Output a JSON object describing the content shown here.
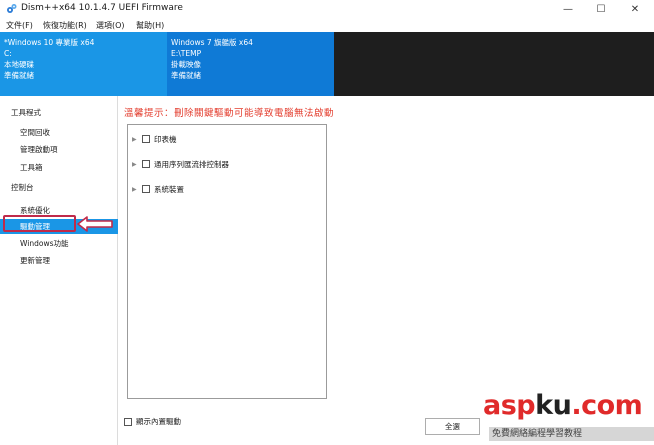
{
  "window": {
    "title": "Dism++x64 10.1.4.7 UEFI Firmware",
    "icon": "dism-gear-icon",
    "controls": {
      "minimize": "—",
      "maximize": "☐",
      "close": "✕"
    }
  },
  "menubar": {
    "items": [
      "文件(F)",
      "恢復功能(R)",
      "選項(O)",
      "幫助(H)"
    ]
  },
  "sessions": [
    {
      "name": "*Windows 10 專業版 x64",
      "path": "C:",
      "type": "本地硬碟",
      "status": "準備就緒",
      "color": "#1a96e6"
    },
    {
      "name": "Windows 7 旗艦版 x64",
      "path": "E:\\TEMP",
      "type": "掛載映像",
      "status": "準備就緒",
      "color": "#0f7ad6"
    }
  ],
  "sidebar": {
    "items": [
      {
        "label": "工具程式",
        "kind": "header"
      },
      {
        "label": "空間回收",
        "kind": "item"
      },
      {
        "label": "管理啟動項",
        "kind": "item"
      },
      {
        "label": "工具箱",
        "kind": "item"
      },
      {
        "label": "控制台",
        "kind": "header"
      },
      {
        "label": "系統優化",
        "kind": "item"
      },
      {
        "label": "驅動管理",
        "kind": "item",
        "active": true
      },
      {
        "label": "Windows功能",
        "kind": "item"
      },
      {
        "label": "更新管理",
        "kind": "item"
      }
    ],
    "accent": "#1a96e6",
    "annotation_color": "#c02a4a"
  },
  "main": {
    "warning": "溫馨提示：刪除關鍵驅動可能導致電腦無法啟動",
    "warning_color": "#e33d2e",
    "tree": [
      {
        "label": "印表機"
      },
      {
        "label": "通用序列匯流排控制器"
      },
      {
        "label": "系統裝置"
      }
    ],
    "show_builtin_label": "顯示內置驅動",
    "select_all_button": "全選"
  },
  "watermark": {
    "main_red_1": "asp",
    "main_dark": "ku",
    "main_red_2": ".com",
    "sub": "免費網絡編程學習教程"
  }
}
